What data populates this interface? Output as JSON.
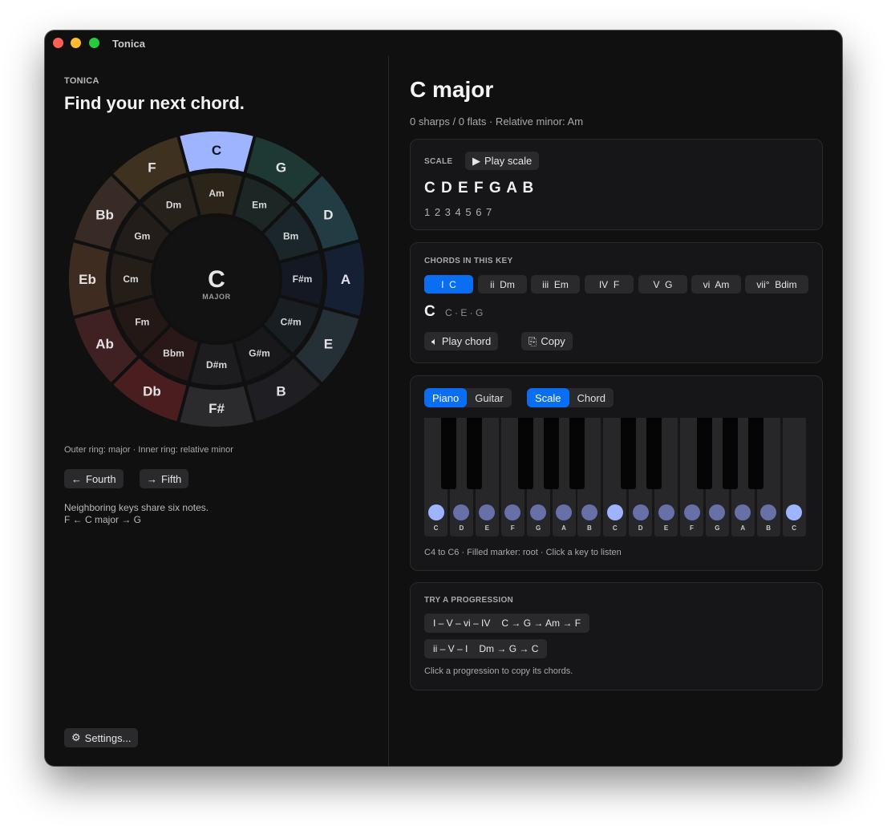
{
  "window": {
    "title": "Tonica"
  },
  "left": {
    "brand": "TONICA",
    "headline": "Find your next chord.",
    "wheel": {
      "majors": [
        "C",
        "G",
        "D",
        "A",
        "E",
        "B",
        "F#",
        "Db",
        "Ab",
        "Eb",
        "Bb",
        "F"
      ],
      "minors": [
        "Am",
        "Em",
        "Bm",
        "F#m",
        "C#m",
        "G#m",
        "D#m",
        "Bbm",
        "Fm",
        "Cm",
        "Gm",
        "Dm"
      ],
      "colors": [
        "#9fb4ff",
        "#1e3833",
        "#213c43",
        "#162035",
        "#253036",
        "#1f1f23",
        "#2b2b2e",
        "#4a1e1e",
        "#3e2120",
        "#3f2c21",
        "#382b26",
        "#3f3120"
      ],
      "selected": "C",
      "center_key": "C",
      "center_mode": "MAJOR"
    },
    "legend": "Outer ring: major  ·  Inner ring: relative minor",
    "fourth_label": "Fourth",
    "fifth_label": "Fifth",
    "note_line1": "Neighboring keys share six notes.",
    "note_line2": "F  ←  C major  →  G",
    "settings_label": "Settings..."
  },
  "right": {
    "key_title": "C major",
    "key_subtitle": "0 sharps / 0 flats  ·  Relative minor: Am",
    "scale": {
      "label": "SCALE",
      "play_label": "Play scale",
      "notes": "C D E F G A B",
      "degrees": "1 2 3 4 5 6 7"
    },
    "chords": {
      "label": "CHORDS IN THIS KEY",
      "items": [
        {
          "roman": "I",
          "name": "C"
        },
        {
          "roman": "ii",
          "name": "Dm"
        },
        {
          "roman": "iii",
          "name": "Em"
        },
        {
          "roman": "IV",
          "name": "F"
        },
        {
          "roman": "V",
          "name": "G"
        },
        {
          "roman": "vi",
          "name": "Am"
        },
        {
          "roman": "vii°",
          "name": "Bdim"
        }
      ],
      "selected_index": 0,
      "current_name": "C",
      "current_notes": "C · E · G",
      "play_label": "Play chord",
      "copy_label": "Copy"
    },
    "instrument": {
      "tabs": [
        "Piano",
        "Guitar"
      ],
      "active_tab": "Piano",
      "modes": [
        "Scale",
        "Chord"
      ],
      "active_mode": "Scale",
      "white_keys": [
        "C",
        "D",
        "E",
        "F",
        "G",
        "A",
        "B",
        "C",
        "D",
        "E",
        "F",
        "G",
        "A",
        "B",
        "C"
      ],
      "root_indices": [
        0,
        7,
        14
      ],
      "caption": "C4 to C6  ·  Filled marker: root  ·  Click a key to listen"
    },
    "progressions": {
      "label": "TRY A PROGRESSION",
      "items": [
        {
          "numerals": "I – V – vi – IV",
          "chords": "C  →  G  →  Am  →  F"
        },
        {
          "numerals": "ii – V – I",
          "chords": "Dm  →  G  →  C"
        }
      ],
      "caption": "Click a progression to copy its chords."
    }
  }
}
